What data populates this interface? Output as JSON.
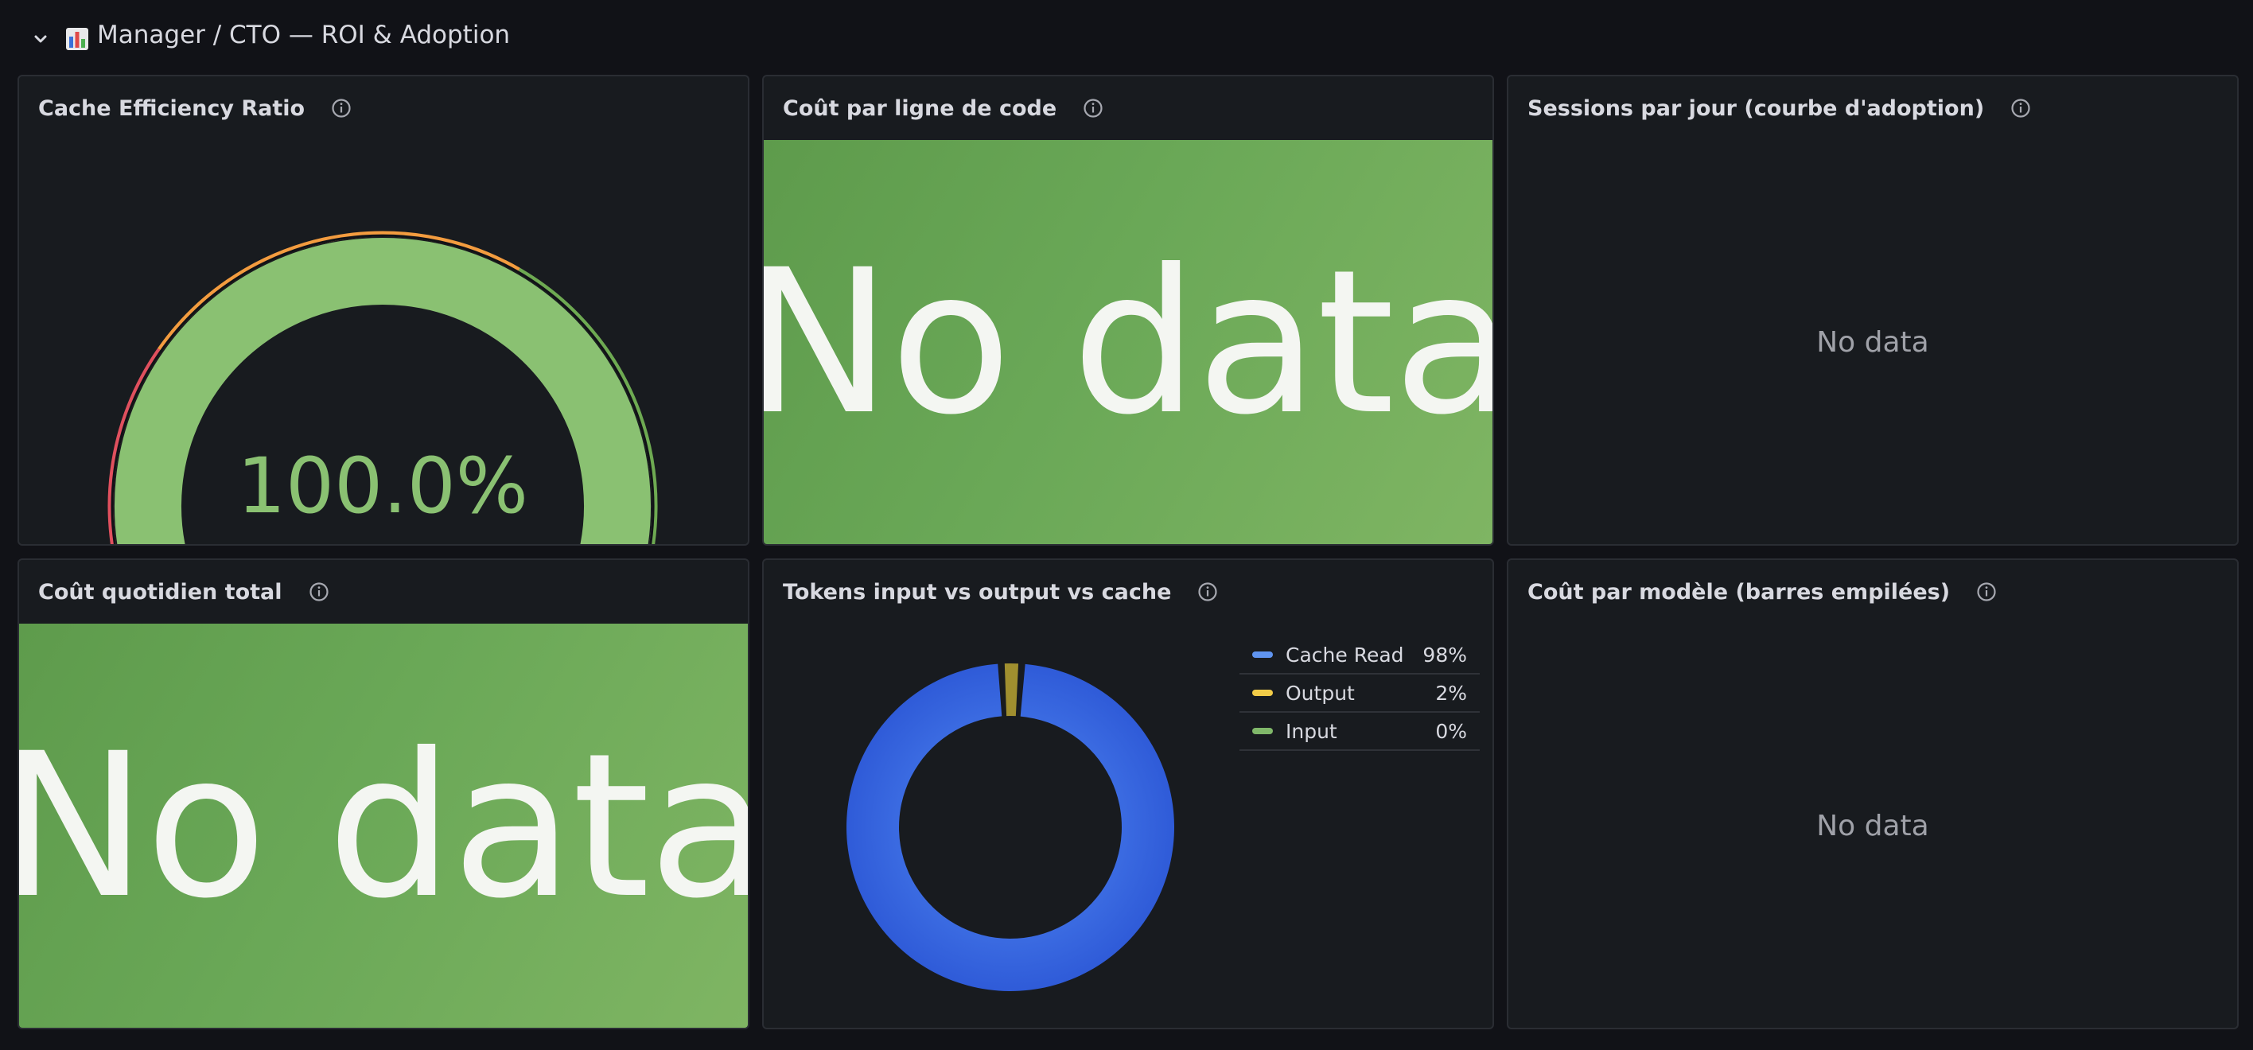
{
  "row": {
    "title": "Manager / CTO — ROI & Adoption",
    "collapse_icon": "chevron-down-icon",
    "dashboard_icon": "bar-chart-icon"
  },
  "panels": {
    "cache_efficiency": {
      "title": "Cache Efficiency Ratio",
      "value_text": "100.0%",
      "gauge": {
        "value": 100,
        "min": 0,
        "max": 100
      },
      "colors": {
        "fill": "#8ac172",
        "red": "#e0505e",
        "orange": "#f39c3f",
        "green": "#6eaa52"
      }
    },
    "cost_per_line": {
      "title": "Coût par ligne de code",
      "no_data": "No data"
    },
    "sessions_per_day": {
      "title": "Sessions par jour (courbe d'adoption)",
      "no_data": "No data"
    },
    "daily_cost": {
      "title": "Coût quotidien total",
      "no_data": "No data"
    },
    "tokens": {
      "title": "Tokens input vs output vs cache",
      "legend": [
        {
          "label": "Cache Read",
          "value": "98%",
          "color": "#5f94f0"
        },
        {
          "label": "Output",
          "value": "2%",
          "color": "#f2cc48"
        },
        {
          "label": "Input",
          "value": "0%",
          "color": "#80b86a"
        }
      ]
    },
    "cost_per_model": {
      "title": "Coût par modèle (barres empilées)",
      "no_data": "No data"
    }
  },
  "chart_data": {
    "type": "pie",
    "categories": [
      "Cache Read",
      "Output",
      "Input"
    ],
    "values": [
      98,
      2,
      0
    ],
    "colors": [
      "#3562e0",
      "#a08f2f",
      "#80b86a"
    ]
  },
  "icons": {
    "info": "info-icon"
  }
}
